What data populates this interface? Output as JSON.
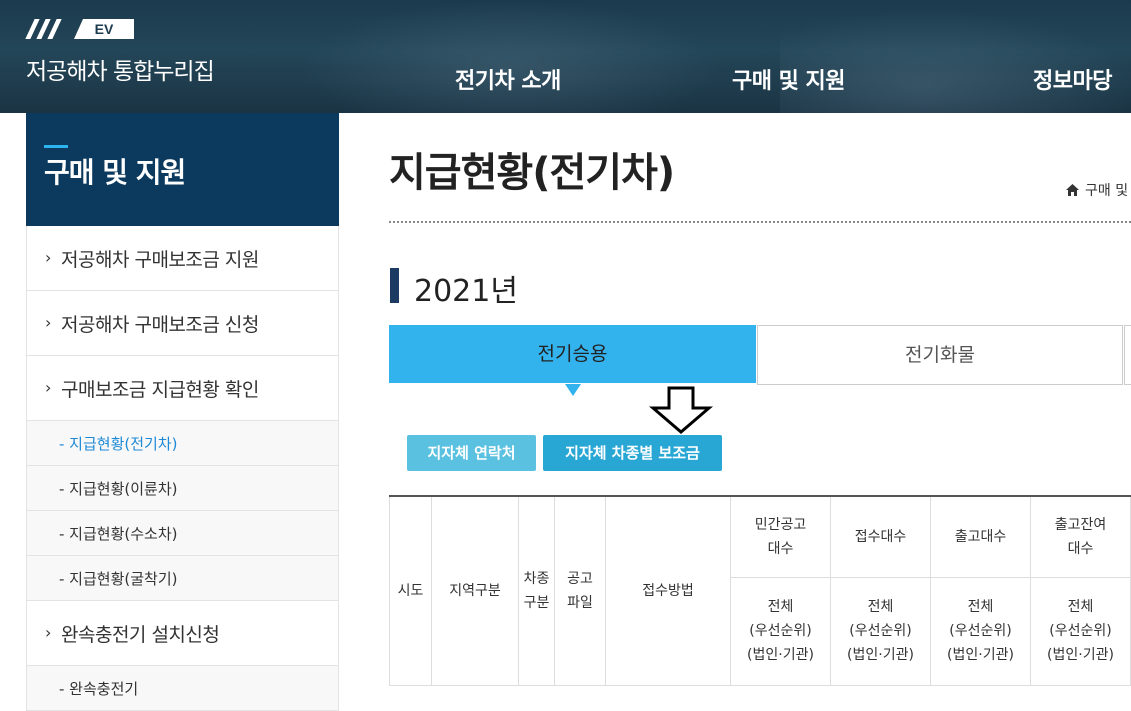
{
  "header": {
    "logo_text": "EV",
    "site_title": "저공해차 통합누리집",
    "nav": [
      "전기차 소개",
      "구매 및 지원",
      "정보마당"
    ]
  },
  "sidebar": {
    "title": "구매 및 지원",
    "items": [
      {
        "label": "저공해차 구매보조금 지원"
      },
      {
        "label": "저공해차 구매보조금 신청"
      },
      {
        "label": "구매보조금 지급현황 확인"
      }
    ],
    "subitems": [
      "- 지급현황(전기차)",
      "- 지급현황(이륜차)",
      "- 지급현황(수소차)",
      "- 지급현황(굴착기)"
    ],
    "item_charger": "완속충전기 설치신청",
    "subitem_charger": "- 완속충전기"
  },
  "main": {
    "page_title": "지급현황(전기차)",
    "breadcrumb": "구매 및",
    "year": "2021년",
    "tabs": [
      "전기승용",
      "전기화물"
    ],
    "buttons": {
      "contact": "지자체 연락처",
      "subsidy": "지자체 차종별 보조금"
    }
  },
  "table": {
    "col_sido": "시도",
    "col_region": "지역구분",
    "col_cartype": [
      "차종",
      "구분"
    ],
    "col_notice": [
      "공고",
      "파일"
    ],
    "col_method": "접수방법",
    "col_private": [
      "민간공고",
      "대수"
    ],
    "col_received": "접수대수",
    "col_released": "출고대수",
    "col_remaining": [
      "출고잔여",
      "대수"
    ],
    "sub_lines": [
      "전체",
      "(우선순위)",
      "(법인·기관)"
    ]
  },
  "colors": {
    "header_bg": "#1c3a4e",
    "sidebar_title_bg": "#0b3a5e",
    "tab_active": "#33b3ee",
    "btn_contact": "#5bc1e0",
    "btn_subsidy": "#28a7d4"
  }
}
